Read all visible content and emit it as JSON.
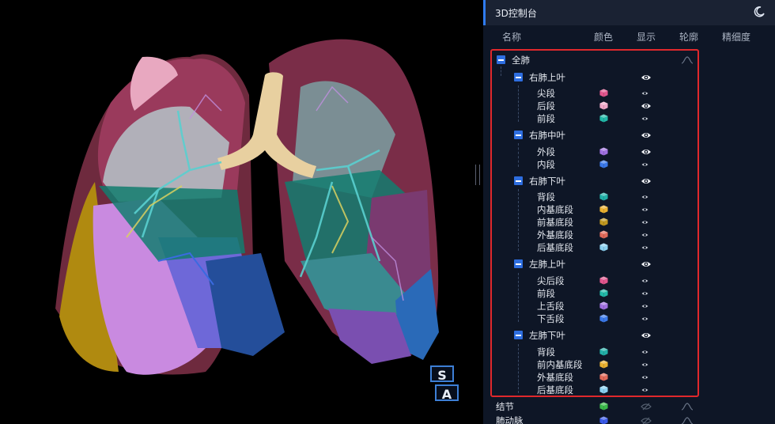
{
  "panel": {
    "title": "3D控制台",
    "columns": [
      "名称",
      "颜色",
      "显示",
      "轮廓",
      "精细度"
    ]
  },
  "tree": [
    {
      "label": "全肺",
      "level": 0,
      "toggle": true,
      "eye": "none",
      "contour": true
    },
    {
      "label": "右肺上叶",
      "level": 1,
      "toggle": true,
      "eye": "big"
    },
    {
      "label": "尖段",
      "level": 2,
      "color": "#e0558c",
      "eye": "small"
    },
    {
      "label": "后段",
      "level": 2,
      "color": "#f0a8c8",
      "eye": "big"
    },
    {
      "label": "前段",
      "level": 2,
      "color": "#22b8a8",
      "eye": "small"
    },
    {
      "label": "右肺中叶",
      "level": 1,
      "toggle": true,
      "eye": "big"
    },
    {
      "label": "外段",
      "level": 2,
      "color": "#a070e0",
      "eye": "big"
    },
    {
      "label": "内段",
      "level": 2,
      "color": "#3a78e8",
      "eye": "small"
    },
    {
      "label": "右肺下叶",
      "level": 1,
      "toggle": true,
      "eye": "big"
    },
    {
      "label": "背段",
      "level": 2,
      "color": "#22b0a8",
      "eye": "small"
    },
    {
      "label": "内基底段",
      "level": 2,
      "color": "#e8b030",
      "eye": "small"
    },
    {
      "label": "前基底段",
      "level": 2,
      "color": "#c09820",
      "eye": "small"
    },
    {
      "label": "外基底段",
      "level": 2,
      "color": "#e06a5a",
      "eye": "small"
    },
    {
      "label": "后基底段",
      "level": 2,
      "color": "#8ad0f0",
      "eye": "small"
    },
    {
      "label": "左肺上叶",
      "level": 1,
      "toggle": true,
      "eye": "big"
    },
    {
      "label": "尖后段",
      "level": 2,
      "color": "#e0558c",
      "eye": "small"
    },
    {
      "label": "前段",
      "level": 2,
      "color": "#22b8a8",
      "eye": "small"
    },
    {
      "label": "上舌段",
      "level": 2,
      "color": "#a070e0",
      "eye": "small"
    },
    {
      "label": "下舌段",
      "level": 2,
      "color": "#3a78e8",
      "eye": "small"
    },
    {
      "label": "左肺下叶",
      "level": 1,
      "toggle": true,
      "eye": "big"
    },
    {
      "label": "背段",
      "level": 2,
      "color": "#22b0a8",
      "eye": "small"
    },
    {
      "label": "前内基底段",
      "level": 2,
      "color": "#e8b030",
      "eye": "small"
    },
    {
      "label": "外基底段",
      "level": 2,
      "color": "#e06a5a",
      "eye": "small"
    },
    {
      "label": "后基底段",
      "level": 2,
      "color": "#8ad0f0",
      "eye": "small"
    },
    {
      "label": "结节",
      "level": -1,
      "color": "#3ab84a",
      "eye": "hidden",
      "contour": true
    },
    {
      "label": "肺动脉",
      "level": -1,
      "color": "#3a5ae8",
      "eye": "hidden",
      "contour": true
    }
  ],
  "orientation_cube": {
    "top": "S",
    "front": "A"
  },
  "colors": {
    "accent": "#2f7bf0",
    "highlight_border": "#e0282c",
    "panel_bg": "#0e1626"
  }
}
